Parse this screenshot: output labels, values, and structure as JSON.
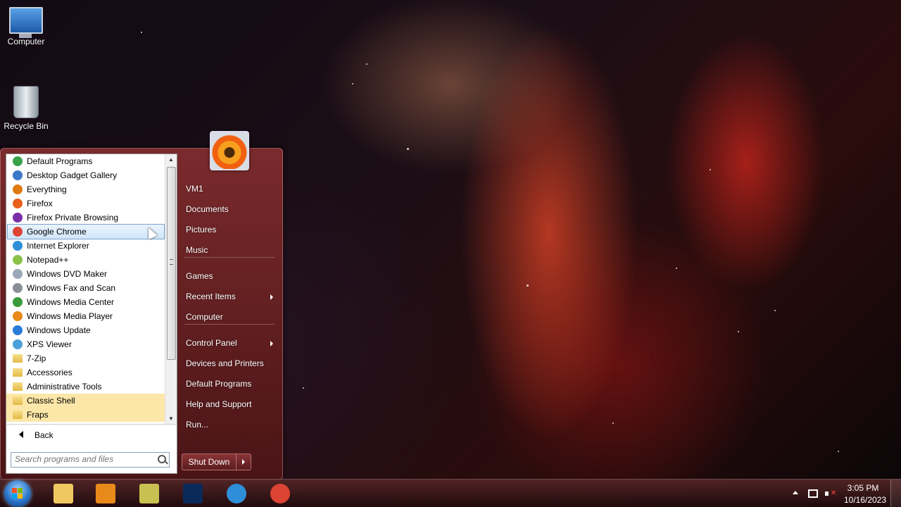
{
  "desktop": {
    "icons": [
      {
        "label": "Computer"
      },
      {
        "label": "Recycle Bin"
      }
    ]
  },
  "start_menu": {
    "programs": [
      {
        "label": "Default Programs",
        "icon": "default-programs-icon",
        "color": "#3aa24a"
      },
      {
        "label": "Desktop Gadget Gallery",
        "icon": "gadget-gallery-icon",
        "color": "#3a78c8"
      },
      {
        "label": "Everything",
        "icon": "magnifier-icon",
        "color": "#e07a10"
      },
      {
        "label": "Firefox",
        "icon": "firefox-icon",
        "color": "#e8601c"
      },
      {
        "label": "Firefox Private Browsing",
        "icon": "firefox-private-icon",
        "color": "#7a2ea8"
      },
      {
        "label": "Google Chrome",
        "icon": "chrome-icon",
        "color": "#dd4433"
      },
      {
        "label": "Internet Explorer",
        "icon": "internet-explorer-icon",
        "color": "#2e8fd8"
      },
      {
        "label": "Notepad++",
        "icon": "notepad-plus-icon",
        "color": "#8ac24a"
      },
      {
        "label": "Windows DVD Maker",
        "icon": "dvd-maker-icon",
        "color": "#9aa8b8"
      },
      {
        "label": "Windows Fax and Scan",
        "icon": "fax-scan-icon",
        "color": "#8a9098"
      },
      {
        "label": "Windows Media Center",
        "icon": "media-center-icon",
        "color": "#3a9a3a"
      },
      {
        "label": "Windows Media Player",
        "icon": "media-player-icon",
        "color": "#e88a1a"
      },
      {
        "label": "Windows Update",
        "icon": "windows-update-icon",
        "color": "#2a7ad8"
      },
      {
        "label": "XPS Viewer",
        "icon": "xps-viewer-icon",
        "color": "#4aa0d8"
      },
      {
        "label": "7-Zip",
        "icon": "folder-icon",
        "color": "#e3b948"
      },
      {
        "label": "Accessories",
        "icon": "folder-icon",
        "color": "#e3b948"
      },
      {
        "label": "Administrative Tools",
        "icon": "folder-icon",
        "color": "#e3b948"
      },
      {
        "label": "Classic Shell",
        "icon": "folder-icon",
        "color": "#e3b948"
      },
      {
        "label": "Fraps",
        "icon": "folder-icon",
        "color": "#e3b948"
      }
    ],
    "hovered_index": 5,
    "back_label": "Back",
    "search_placeholder": "Search programs and files",
    "right_items": [
      {
        "label": "VM1",
        "has_submenu": false
      },
      {
        "label": "Documents",
        "has_submenu": false
      },
      {
        "label": "Pictures",
        "has_submenu": false
      },
      {
        "label": "Music",
        "has_submenu": false
      },
      {
        "label": "Games",
        "has_submenu": false
      },
      {
        "label": "Recent Items",
        "has_submenu": true
      },
      {
        "label": "Computer",
        "has_submenu": false
      },
      {
        "label": "Control Panel",
        "has_submenu": true
      },
      {
        "label": "Devices and Printers",
        "has_submenu": false
      },
      {
        "label": "Default Programs",
        "has_submenu": false
      },
      {
        "label": "Help and Support",
        "has_submenu": false
      },
      {
        "label": "Run...",
        "has_submenu": false
      }
    ],
    "shutdown_label": "Shut Down"
  },
  "taskbar": {
    "pinned": [
      {
        "name": "explorer",
        "icon": "folder-icon",
        "color": "#f0c860"
      },
      {
        "name": "media-player",
        "icon": "media-player-icon",
        "color": "#e88a1a"
      },
      {
        "name": "app-99",
        "icon": "app-99-icon",
        "color": "#c8c050"
      },
      {
        "name": "photoshop",
        "icon": "photoshop-icon",
        "color": "#0a2a5a"
      },
      {
        "name": "internet-explorer",
        "icon": "internet-explorer-icon",
        "color": "#2e8fd8"
      },
      {
        "name": "chrome",
        "icon": "chrome-icon",
        "color": "#dd4433"
      }
    ],
    "clock": {
      "time": "3:05 PM",
      "date": "10/16/2023"
    }
  }
}
